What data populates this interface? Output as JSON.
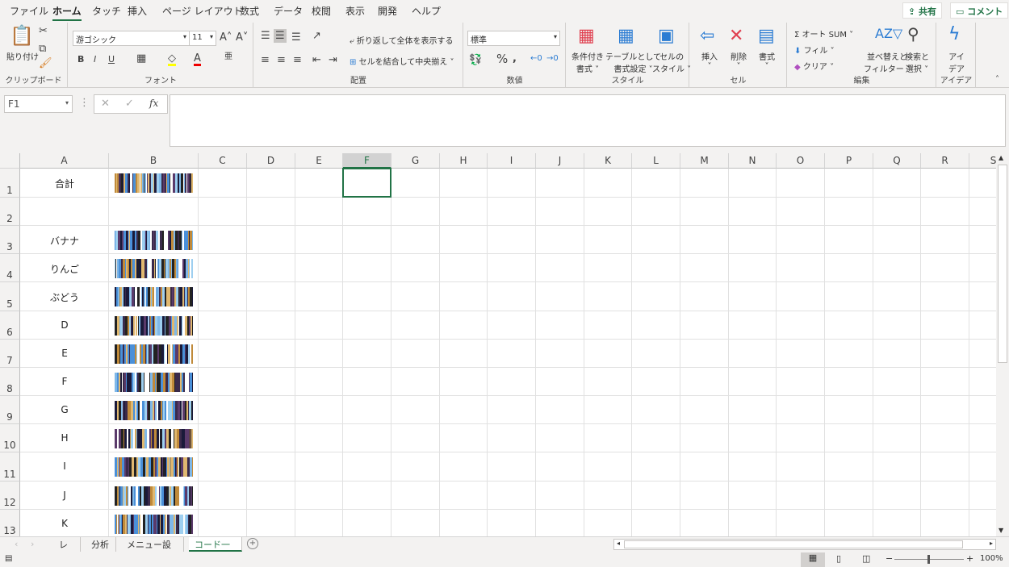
{
  "menu_tabs": [
    "ファイル",
    "ホーム",
    "タッチ",
    "挿入",
    "ページ レイアウト",
    "数式",
    "データ",
    "校閲",
    "表示",
    "開発",
    "ヘルプ"
  ],
  "active_tab": "ホーム",
  "share_label": "共有",
  "comment_label": "コメント",
  "ribbon": {
    "clipboard": {
      "paste": "貼り付け",
      "label": "クリップボード"
    },
    "font": {
      "name": "游ゴシック",
      "size": "11",
      "label": "フォント",
      "bold": "B",
      "italic": "I",
      "underline": "U"
    },
    "alignment": {
      "wrap": "折り返して全体を表示する",
      "merge": "セルを結合して中央揃え",
      "label": "配置"
    },
    "number": {
      "format": "標準",
      "label": "数値",
      "percent": "%"
    },
    "styles": {
      "conditional": "条件付き",
      "conditional2": "書式",
      "table": "テーブルとして",
      "table2": "書式設定",
      "cell": "セルの",
      "cell2": "スタイル",
      "label": "スタイル"
    },
    "cells": {
      "insert": "挿入",
      "delete": "削除",
      "format": "書式",
      "label": "セル"
    },
    "editing": {
      "autosum": "オート SUM",
      "fill": "フィル",
      "clear": "クリア",
      "sort": "並べ替えと",
      "sort2": "フィルター",
      "find": "検索と",
      "find2": "選択",
      "label": "編集"
    },
    "ideas": {
      "l1": "アイ",
      "l2": "デア",
      "label": "アイデア"
    }
  },
  "name_box": "F1",
  "fx": "fx",
  "columns": [
    "A",
    "B",
    "C",
    "D",
    "E",
    "F",
    "G",
    "H",
    "I",
    "J",
    "K",
    "L",
    "M",
    "N",
    "O",
    "P",
    "Q",
    "R",
    "S"
  ],
  "selected_column": "F",
  "rows": [
    {
      "n": "1",
      "a": "合計",
      "barcode": true
    },
    {
      "n": "2",
      "a": "",
      "barcode": false
    },
    {
      "n": "3",
      "a": "バナナ",
      "barcode": true
    },
    {
      "n": "4",
      "a": "りんご",
      "barcode": true
    },
    {
      "n": "5",
      "a": "ぶどう",
      "barcode": true
    },
    {
      "n": "6",
      "a": "D",
      "barcode": true
    },
    {
      "n": "7",
      "a": "E",
      "barcode": true
    },
    {
      "n": "8",
      "a": "F",
      "barcode": true
    },
    {
      "n": "9",
      "a": "G",
      "barcode": true
    },
    {
      "n": "10",
      "a": "H",
      "barcode": true
    },
    {
      "n": "11",
      "a": "I",
      "barcode": true
    },
    {
      "n": "12",
      "a": "J",
      "barcode": true
    },
    {
      "n": "13",
      "a": "K",
      "barcode": true
    }
  ],
  "sheets": [
    "レジ",
    "分析",
    "メニュー設定",
    "コード一覧"
  ],
  "active_sheet": "コード一覧",
  "zoom": "100%"
}
